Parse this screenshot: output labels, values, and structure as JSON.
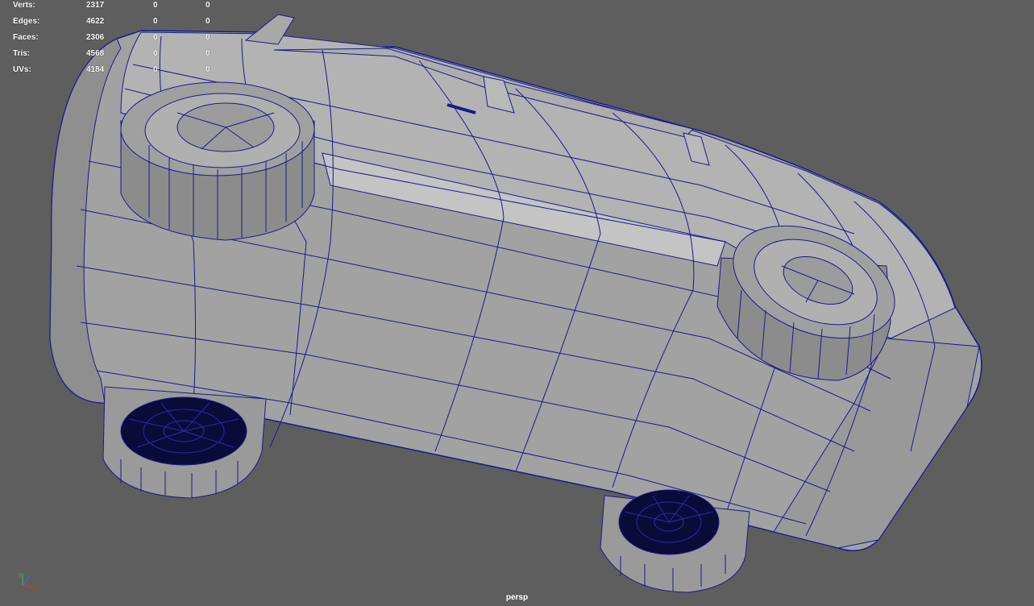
{
  "hud": {
    "rows": [
      {
        "label": "Verts:",
        "a": "2317",
        "b": "0",
        "c": "0"
      },
      {
        "label": "Edges:",
        "a": "4622",
        "b": "0",
        "c": "0"
      },
      {
        "label": "Faces:",
        "a": "2306",
        "b": "0",
        "c": "0"
      },
      {
        "label": "Tris:",
        "a": "4568",
        "b": "0",
        "c": "0"
      },
      {
        "label": "UVs:",
        "a": "4184",
        "b": "0",
        "c": "0"
      }
    ]
  },
  "viewport": {
    "camera": "persp",
    "axis": {
      "x": "x",
      "y": "y",
      "z": "z"
    }
  },
  "colors": {
    "background": "#5e5e5e",
    "mesh_fill": "#a4a4a4",
    "mesh_dark": "#7e7e7e",
    "mesh_light": "#bdbdbd",
    "wire": "#1a1a8c",
    "tire_inner": "#0b0b3a"
  }
}
